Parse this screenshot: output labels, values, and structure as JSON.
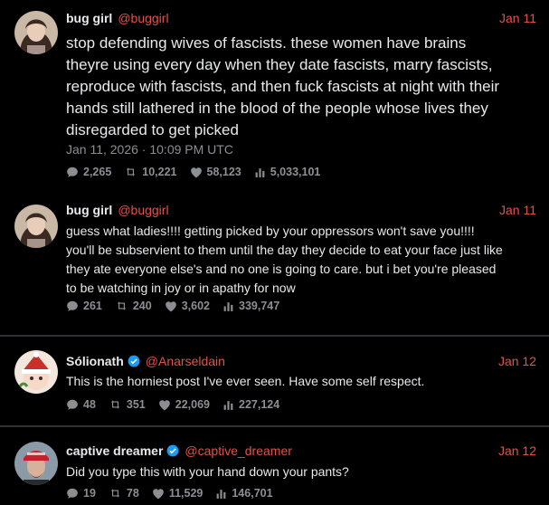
{
  "posts": [
    {
      "name": "bug girl",
      "handle": "@buggirl",
      "date": "Jan 11",
      "text_lines": [
        "stop defending wives of fascists. these women have brains",
        "theyre using every day when they date fascists, marry fascists,",
        "reproduce with fascists, and then fuck fascists at night with their",
        "hands still lathered in the blood of the people whose lives they",
        "disregarded to get picked"
      ],
      "timestamp": "Jan 11, 2026 · 10:09 PM UTC",
      "replies": "2,265",
      "retweets": "10,221",
      "likes": "58,123",
      "views": "5,033,101",
      "verified": false
    },
    {
      "name": "bug girl",
      "handle": "@buggirl",
      "date": "Jan 11",
      "text_lines": [
        "guess what ladies!!!! getting picked by your oppressors won't save you!!!!",
        "you'll be subservient to them until the day they decide to eat your face just like",
        "they ate everyone else's and no one is going to care. but i bet you're pleased",
        "to be watching in joy or in apathy for now"
      ],
      "replies": "261",
      "retweets": "240",
      "likes": "3,602",
      "views": "339,747",
      "verified": false
    },
    {
      "name": "Sólionath",
      "handle": "@Anarseldain",
      "date": "Jan 12",
      "text_lines": [
        "This is the horniest post I've ever seen. Have some self respect."
      ],
      "replies": "48",
      "retweets": "351",
      "likes": "22,069",
      "views": "227,124",
      "verified": true
    },
    {
      "name": "captive dreamer",
      "handle": "@captive_dreamer",
      "date": "Jan 12",
      "text_lines": [
        "Did you type this with your hand down your pants?"
      ],
      "replies": "19",
      "retweets": "78",
      "likes": "11,529",
      "views": "146,701",
      "verified": true
    }
  ],
  "icons": {
    "reply": "reply-icon",
    "retweet": "retweet-icon",
    "like": "heart-icon",
    "views": "views-icon",
    "verified": "verified-badge-icon"
  },
  "colors": {
    "accent": "#e0524a",
    "muted": "#8b8f94",
    "text": "#e7e9ea",
    "verified": "#1d9bf0",
    "background": "#000000"
  }
}
